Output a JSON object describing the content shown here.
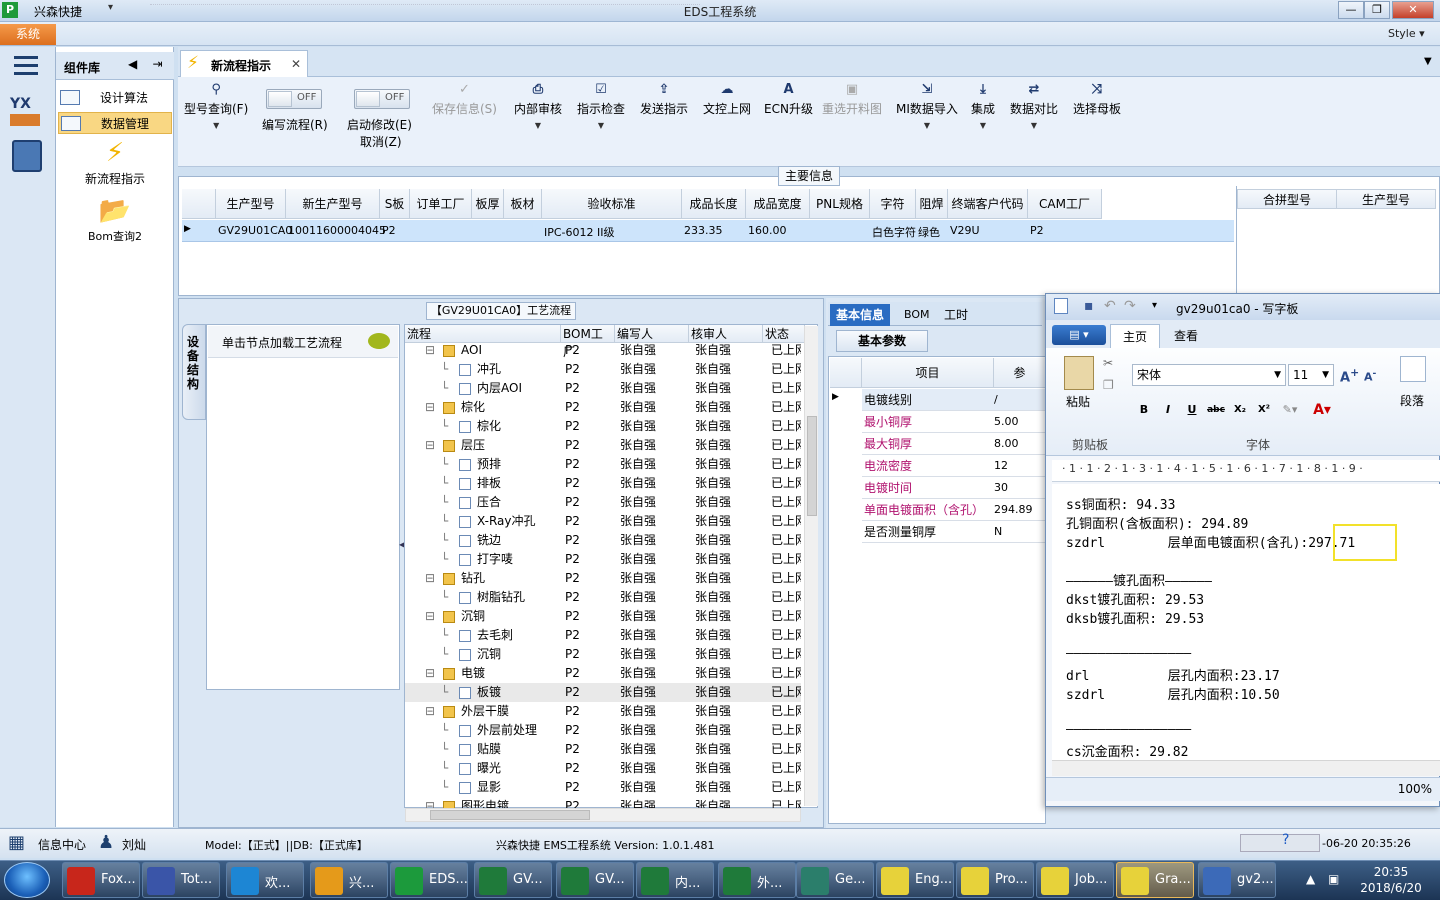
{
  "window": {
    "app_name": "兴森快捷",
    "title": "EDS工程系统"
  },
  "menu": {
    "system_label": "系统",
    "style_label": "Style"
  },
  "component_panel": {
    "title": "组件库",
    "items": [
      {
        "label": "设计算法"
      },
      {
        "label": "数据管理"
      }
    ],
    "big_items": [
      {
        "label": "新流程指示"
      },
      {
        "label": "Bom查询2"
      }
    ]
  },
  "doc_tab": {
    "label": "新流程指示"
  },
  "ribbon": {
    "model_query": "型号查询(F)",
    "toggle1": {
      "state": "OFF",
      "label": "编写流程(R)"
    },
    "toggle2": {
      "state": "OFF",
      "label": "启动修改(E)",
      "sub": "取消(Z)"
    },
    "buttons": [
      {
        "label": "保存信息(S)",
        "icon": "check-icon",
        "disabled": true
      },
      {
        "label": "内部审核",
        "icon": "print-icon",
        "disabled": false
      },
      {
        "label": "指示检查",
        "icon": "checkbox-icon",
        "disabled": false
      },
      {
        "label": "发送指示",
        "icon": "upload-icon",
        "disabled": false
      },
      {
        "label": "文控上网",
        "icon": "cloud-icon",
        "disabled": false
      },
      {
        "label": "ECN升级",
        "icon": "ecn-icon",
        "disabled": false
      },
      {
        "label": "重选开料图",
        "icon": "image-icon",
        "disabled": true
      },
      {
        "label": "MI数据导入",
        "icon": "import-icon",
        "disabled": false
      },
      {
        "label": "集成",
        "icon": "download-icon",
        "disabled": false
      },
      {
        "label": "数据对比",
        "icon": "compare-icon",
        "disabled": false
      },
      {
        "label": "选择母板",
        "icon": "shuffle-icon",
        "disabled": false
      }
    ]
  },
  "main_info": {
    "group_label": "主要信息",
    "columns": [
      "生产型号",
      "新生产型号",
      "S板",
      "订单工厂",
      "板厚",
      "板材",
      "验收标准",
      "成品长度",
      "成品宽度",
      "PNL规格",
      "字符",
      "阻焊",
      "终端客户代码",
      "CAM工厂"
    ],
    "row": [
      "GV29U01CA0",
      "10011600004045",
      "P2",
      "",
      "",
      "",
      "IPC-6012 II级",
      "233.35",
      "160.00",
      "",
      "白色字符",
      "绿色",
      "V29U",
      "P2"
    ],
    "right_columns": [
      "合拼型号",
      "生产型号"
    ]
  },
  "process": {
    "title": "【GV29U01CA0】工艺流程",
    "side_tab": "设备结构",
    "node_hint": "单击节点加载工艺流程",
    "columns": [
      "流程",
      "BOM工厂",
      "编写人",
      "核审人",
      "状态"
    ],
    "rows": [
      {
        "name": "AOI",
        "level": 1,
        "type": "folder",
        "bom": "P2",
        "writer": "张自强",
        "reviewer": "张自强",
        "status": "已上网"
      },
      {
        "name": "冲孔",
        "level": 2,
        "type": "file",
        "bom": "P2",
        "writer": "张自强",
        "reviewer": "张自强",
        "status": "已上网"
      },
      {
        "name": "内层AOI",
        "level": 2,
        "type": "file",
        "bom": "P2",
        "writer": "张自强",
        "reviewer": "张自强",
        "status": "已上网"
      },
      {
        "name": "棕化",
        "level": 1,
        "type": "folder",
        "bom": "P2",
        "writer": "张自强",
        "reviewer": "张自强",
        "status": "已上网"
      },
      {
        "name": "棕化",
        "level": 2,
        "type": "file",
        "bom": "P2",
        "writer": "张自强",
        "reviewer": "张自强",
        "status": "已上网"
      },
      {
        "name": "层压",
        "level": 1,
        "type": "folder",
        "bom": "P2",
        "writer": "张自强",
        "reviewer": "张自强",
        "status": "已上网"
      },
      {
        "name": "预排",
        "level": 2,
        "type": "file",
        "bom": "P2",
        "writer": "张自强",
        "reviewer": "张自强",
        "status": "已上网"
      },
      {
        "name": "排板",
        "level": 2,
        "type": "file",
        "bom": "P2",
        "writer": "张自强",
        "reviewer": "张自强",
        "status": "已上网"
      },
      {
        "name": "压合",
        "level": 2,
        "type": "file",
        "bom": "P2",
        "writer": "张自强",
        "reviewer": "张自强",
        "status": "已上网"
      },
      {
        "name": "X-Ray冲孔",
        "level": 2,
        "type": "file",
        "bom": "P2",
        "writer": "张自强",
        "reviewer": "张自强",
        "status": "已上网"
      },
      {
        "name": "铣边",
        "level": 2,
        "type": "file",
        "bom": "P2",
        "writer": "张自强",
        "reviewer": "张自强",
        "status": "已上网"
      },
      {
        "name": "打字唛",
        "level": 2,
        "type": "file",
        "bom": "P2",
        "writer": "张自强",
        "reviewer": "张自强",
        "status": "已上网"
      },
      {
        "name": "钻孔",
        "level": 1,
        "type": "folder",
        "bom": "P2",
        "writer": "张自强",
        "reviewer": "张自强",
        "status": "已上网"
      },
      {
        "name": "树脂钻孔",
        "level": 2,
        "type": "file",
        "bom": "P2",
        "writer": "张自强",
        "reviewer": "张自强",
        "status": "已上网"
      },
      {
        "name": "沉铜",
        "level": 1,
        "type": "folder",
        "bom": "P2",
        "writer": "张自强",
        "reviewer": "张自强",
        "status": "已上网"
      },
      {
        "name": "去毛刺",
        "level": 2,
        "type": "file",
        "bom": "P2",
        "writer": "张自强",
        "reviewer": "张自强",
        "status": "已上网"
      },
      {
        "name": "沉铜",
        "level": 2,
        "type": "file",
        "bom": "P2",
        "writer": "张自强",
        "reviewer": "张自强",
        "status": "已上网"
      },
      {
        "name": "电镀",
        "level": 1,
        "type": "folder",
        "bom": "P2",
        "writer": "张自强",
        "reviewer": "张自强",
        "status": "已上网"
      },
      {
        "name": "板镀",
        "level": 2,
        "type": "file",
        "bom": "P2",
        "writer": "张自强",
        "reviewer": "张自强",
        "status": "已上网",
        "selected": true
      },
      {
        "name": "外层干膜",
        "level": 1,
        "type": "folder",
        "bom": "P2",
        "writer": "张自强",
        "reviewer": "张自强",
        "status": "已上网"
      },
      {
        "name": "外层前处理",
        "level": 2,
        "type": "file",
        "bom": "P2",
        "writer": "张自强",
        "reviewer": "张自强",
        "status": "已上网"
      },
      {
        "name": "贴膜",
        "level": 2,
        "type": "file",
        "bom": "P2",
        "writer": "张自强",
        "reviewer": "张自强",
        "status": "已上网"
      },
      {
        "name": "曝光",
        "level": 2,
        "type": "file",
        "bom": "P2",
        "writer": "张自强",
        "reviewer": "张自强",
        "status": "已上网"
      },
      {
        "name": "显影",
        "level": 2,
        "type": "file",
        "bom": "P2",
        "writer": "张自强",
        "reviewer": "张自强",
        "status": "已上网"
      },
      {
        "name": "图形电镀",
        "level": 1,
        "type": "folder",
        "bom": "P2",
        "writer": "张自强",
        "reviewer": "张自强",
        "status": "已上网"
      }
    ]
  },
  "info_panel": {
    "tabs": [
      "基本信息",
      "BOM",
      "工时"
    ],
    "subtab": "基本参数",
    "columns": [
      "项目",
      "参"
    ],
    "rows": [
      {
        "key": "电镀线别",
        "value": "/",
        "pink": false
      },
      {
        "key": "最小铜厚",
        "value": "5.00",
        "pink": true
      },
      {
        "key": "最大铜厚",
        "value": "8.00",
        "pink": true
      },
      {
        "key": "电流密度",
        "value": "12",
        "pink": true
      },
      {
        "key": "电镀时间",
        "value": "30",
        "pink": true
      },
      {
        "key": "单面电镀面积（含孔）",
        "value": "294.89",
        "pink": true
      },
      {
        "key": "是否测量铜厚",
        "value": "N",
        "pink": false
      }
    ]
  },
  "wordpad": {
    "title": "gv29u01ca0 - 写字板",
    "tabs": [
      "主页",
      "查看"
    ],
    "paste_label": "粘贴",
    "clipboard_group": "剪贴板",
    "font_name": "宋体",
    "font_size": "11",
    "font_group": "字体",
    "paragraph_label": "段落",
    "ruler": "· 1 · 1 · 2 · 1 · 3 · 1 · 4 · 1 · 5 · 1 · 6 · 1 · 7 · 1 · 8 · 1 · 9 ·",
    "lines": [
      "ss铜面积: 94.33",
      "孔铜面积(含板面积): 294.89",
      "szdrl        层单面电镀面积(含孔):297.71",
      "",
      "——————镀孔面积——————",
      "dkst镀孔面积: 29.53",
      "dksb镀孔面积: 29.53",
      "",
      "————————————————",
      "drl          层孔内面积:23.17",
      "szdrl        层孔内面积:10.50",
      "",
      "————————————————",
      "cs沉金面积: 29.82"
    ],
    "zoom": "100%"
  },
  "statusbar": {
    "info_center": "信息中心",
    "user": "刘灿",
    "model_db": "Model:【正式】||DB:【正式库】",
    "system_version": "兴森快捷 EMS工程系统 Version: 1.0.1.481",
    "datetime": "-06-20 20:35:26"
  },
  "taskbar": {
    "items": [
      {
        "label": "Fox...",
        "icon": "foxit-icon",
        "color": "#c8261b"
      },
      {
        "label": "Tot...",
        "icon": "save-icon",
        "color": "#3a55a8"
      },
      {
        "label": "欢...",
        "icon": "ie-icon",
        "color": "#1d86d4"
      },
      {
        "label": "兴...",
        "icon": "shell-icon",
        "color": "#e59a1a"
      },
      {
        "label": "EDS...",
        "icon": "eds-icon",
        "color": "#1c9a3c"
      },
      {
        "label": "GV...",
        "icon": "excel-icon",
        "color": "#1f7a3a"
      },
      {
        "label": "GV...",
        "icon": "excel-icon",
        "color": "#1f7a3a"
      },
      {
        "label": "内...",
        "icon": "excel-icon",
        "color": "#1f7a3a"
      },
      {
        "label": "外...",
        "icon": "excel-icon",
        "color": "#1f7a3a"
      },
      {
        "label": "Ge...",
        "icon": "eye-icon",
        "color": "#2b7e6b"
      },
      {
        "label": "Eng...",
        "icon": "x-icon",
        "color": "#e7d23a"
      },
      {
        "label": "Pro...",
        "icon": "x-icon",
        "color": "#e7d23a"
      },
      {
        "label": "Job...",
        "icon": "x-icon",
        "color": "#e7d23a"
      },
      {
        "label": "Gra...",
        "icon": "x-icon",
        "color": "#e7d23a",
        "active": true
      },
      {
        "label": "gv2...",
        "icon": "wordpad-icon",
        "color": "#3c6ab8"
      }
    ],
    "time": "20:35",
    "date": "2018/6/20"
  }
}
